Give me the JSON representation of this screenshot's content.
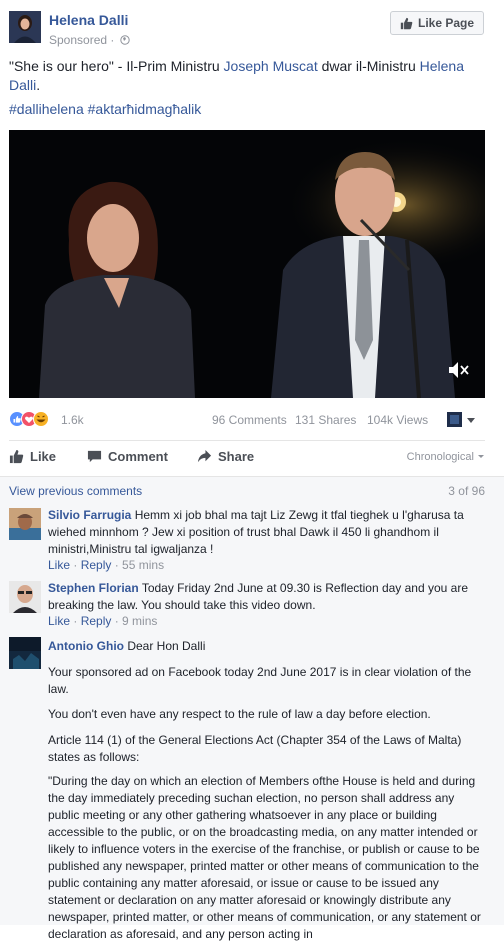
{
  "post": {
    "author": "Helena Dalli",
    "sponsored": "Sponsored ·",
    "like_page": "Like Page",
    "text_parts": [
      "\"She is our hero\" - Il-Prim Ministru ",
      "Joseph Muscat",
      " dwar il-Ministru ",
      "Helena Dalli",
      "."
    ],
    "hashtags": "#dallihelena #aktarħidmagħalik"
  },
  "stats": {
    "reactions": "1.6k",
    "comments": "96 Comments",
    "shares": "131 Shares",
    "views": "104k Views"
  },
  "actions": {
    "like": "Like",
    "comment": "Comment",
    "share": "Share",
    "sort": "Chronological"
  },
  "comments_header": {
    "view_previous": "View previous comments",
    "count": "3 of 96"
  },
  "comments": [
    {
      "name": "Silvio Farrugia",
      "text": "Hemm xi job bhal ma tajt Liz Zewg it tfal tieghek u l'gharusa ta wiehed minnhom ? Jew xi position of trust bhal Dawk il 450 li ghandhom il ministri,Ministru tal igwaljanza !",
      "like": "Like",
      "reply": "Reply",
      "time": "55 mins"
    },
    {
      "name": "Stephen Florian",
      "text": "Today Friday 2nd June at 09.30 is Reflection day and you are breaking the law. You should take this video down.",
      "like": "Like",
      "reply": "Reply",
      "time": "9 mins"
    },
    {
      "name": "Antonio Ghio",
      "text": "Dear Hon Dalli",
      "paragraphs": [
        "Your sponsored ad on Facebook today 2nd June 2017 is in clear violation of the law.",
        "You don't even have any respect to the rule of law a day before election.",
        "Article 114 (1) of the General Elections Act (Chapter 354 of the Laws of Malta) states as follows:",
        "\"During the day on which an election of Members ofthe House is held and during the day immediately preceding suchan election, no person shall address any public meeting or any other gathering whatsoever in any place or building accessible to the public, or on the broadcasting media, on any matter intended or likely to influence voters in the exercise of the franchise, or publish or cause to be published any newspaper, printed matter or other means of communication to the public containing any matter aforesaid, or issue or cause to be issued any statement or declaration on any matter aforesaid or knowingly distribute any newspaper, printed matter, or other means of communication, or any statement or declaration as aforesaid, and any person acting in"
      ]
    }
  ],
  "icons": [
    "sponsored-globe-icon",
    "thumbs-up-icon",
    "comment-icon",
    "share-icon",
    "mute-icon",
    "reaction-icons",
    "dropdown-icon"
  ],
  "colors": {
    "link": "#365899",
    "muted": "#90949c",
    "like_blue": "#5890ff",
    "love_red": "#f25268",
    "haha_yellow": "#f7b125"
  }
}
